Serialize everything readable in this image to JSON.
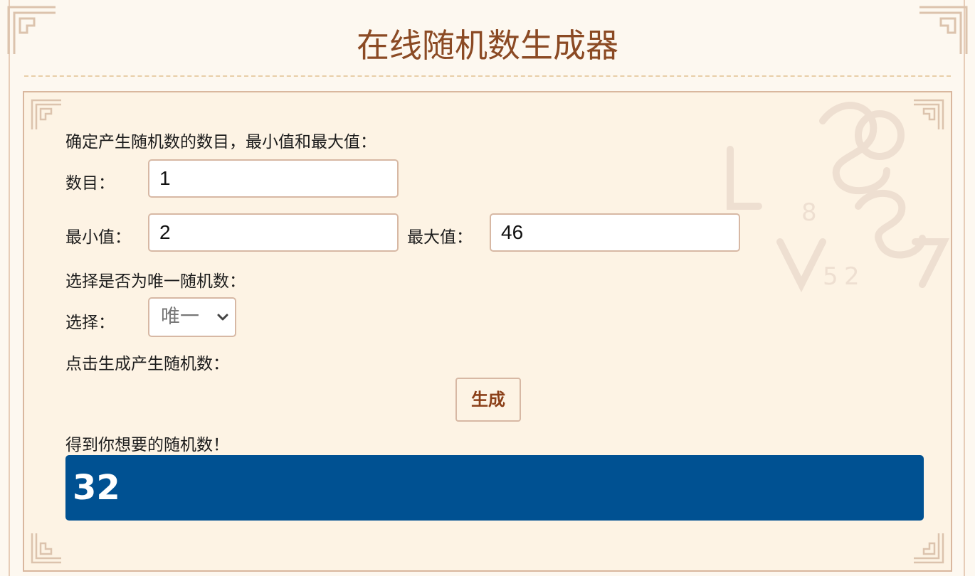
{
  "header": {
    "title": "在线随机数生成器"
  },
  "form": {
    "intro": "确定产生随机数的数目，最小值和最大值：",
    "count_label": "数目：",
    "count_value": "1",
    "min_label": "最小值：",
    "min_value": "2",
    "max_label": "最大值：",
    "max_value": "46",
    "unique_prompt": "选择是否为唯一随机数：",
    "select_label": "选择：",
    "select_value": "唯一",
    "generate_prompt": "点击生成产生随机数：",
    "generate_button": "生成",
    "result_label": "得到你想要的随机数！",
    "result_value": "32"
  },
  "colors": {
    "title": "#8b4a24",
    "result_background": "#005192",
    "button_text": "#8b3f18",
    "panel_background": "#fdf3e4"
  }
}
